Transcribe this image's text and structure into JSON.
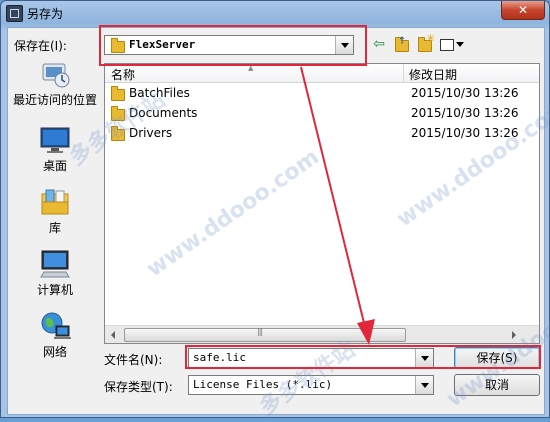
{
  "window": {
    "title": "另存为",
    "close_label": "✕"
  },
  "location": {
    "label": "保存在(I):",
    "value": "FlexServer"
  },
  "toolbar": {
    "back_icon": "back-arrow-icon",
    "up_icon": "up-folder-icon",
    "new_folder_icon": "new-folder-icon",
    "view_icon": "view-menu-icon"
  },
  "places": [
    {
      "label": "最近访问的位置",
      "icon": "recent-places-icon"
    },
    {
      "label": "桌面",
      "icon": "desktop-icon"
    },
    {
      "label": "库",
      "icon": "library-icon"
    },
    {
      "label": "计算机",
      "icon": "computer-icon"
    },
    {
      "label": "网络",
      "icon": "network-icon"
    }
  ],
  "filelist": {
    "columns": [
      "名称",
      "修改日期"
    ],
    "rows": [
      {
        "name": "BatchFiles",
        "date": "2015/10/30 13:26"
      },
      {
        "name": "Documents",
        "date": "2015/10/30 13:26"
      },
      {
        "name": "Drivers",
        "date": "2015/10/30 13:26"
      }
    ]
  },
  "filename": {
    "label": "文件名(N):",
    "value": "safe.lic"
  },
  "filetype": {
    "label": "保存类型(T):",
    "value": "License Files (*.lic)"
  },
  "buttons": {
    "save": "保存(S)",
    "cancel": "取消"
  },
  "watermark": "www.ddooo.com",
  "watermark_cn": "多多软件站",
  "colors": {
    "annotation_red": "#e0283a",
    "folder_yellow": "#e8b931"
  }
}
